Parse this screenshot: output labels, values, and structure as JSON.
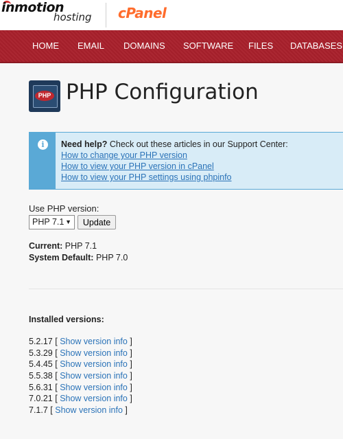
{
  "brand": {
    "inmotion_word": "inmotion",
    "hosting_word": "hosting",
    "cpanel": "cPanel"
  },
  "nav": [
    "HOME",
    "EMAIL",
    "DOMAINS",
    "SOFTWARE",
    "FILES",
    "DATABASES"
  ],
  "page": {
    "icon_text": "PHP",
    "title": "PHP Configuration"
  },
  "help": {
    "heading_bold": "Need help?",
    "heading_rest": " Check out these articles in our Support Center:",
    "links": [
      "How to change your PHP version",
      "How to view your PHP version in cPanel",
      "How to view your PHP settings using phpinfo"
    ]
  },
  "selector": {
    "label": "Use PHP version:",
    "selected": "PHP 7.1",
    "button": "Update"
  },
  "status": {
    "current_label": "Current:",
    "current_value": " PHP 7.1",
    "default_label": "System Default:",
    "default_value": " PHP 7.0"
  },
  "installed": {
    "heading": "Installed versions:",
    "link_text": "Show version info",
    "versions": [
      "5.2.17",
      "5.3.29",
      "5.4.45",
      "5.5.38",
      "5.6.31",
      "7.0.21",
      "7.1.7"
    ]
  },
  "colors": {
    "nav_bg": "#a8202b",
    "link": "#2b73b8",
    "info_accent": "#5aa9d6",
    "cpanel_orange": "#ff6c2c"
  }
}
